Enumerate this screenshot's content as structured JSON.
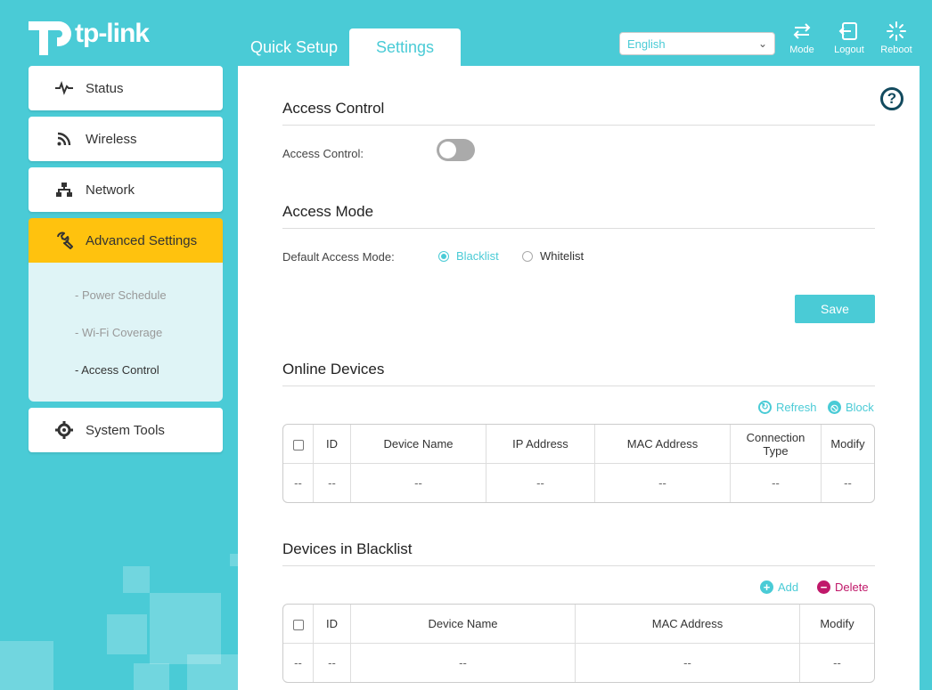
{
  "brand": {
    "name": "tp-link"
  },
  "tabs": {
    "quick_setup": "Quick Setup",
    "settings": "Settings"
  },
  "language": {
    "selected": "English"
  },
  "header_buttons": {
    "mode": "Mode",
    "logout": "Logout",
    "reboot": "Reboot"
  },
  "sidebar": {
    "status": "Status",
    "wireless": "Wireless",
    "network": "Network",
    "advanced": "Advanced Settings",
    "sub_items": [
      "Power Schedule",
      "Wi-Fi Coverage",
      "Access Control"
    ],
    "system_tools": "System Tools"
  },
  "access_control": {
    "title": "Access Control",
    "label": "Access Control:",
    "enabled": false
  },
  "access_mode": {
    "title": "Access Mode",
    "label": "Default Access Mode:",
    "options": [
      "Blacklist",
      "Whitelist"
    ],
    "selected": "Blacklist",
    "save": "Save"
  },
  "online_devices": {
    "title": "Online Devices",
    "refresh": "Refresh",
    "block": "Block",
    "columns": [
      "ID",
      "Device Name",
      "IP Address",
      "MAC Address",
      "Connection Type",
      "Modify"
    ],
    "row": [
      "--",
      "--",
      "--",
      "--",
      "--",
      "--",
      "--"
    ]
  },
  "blacklist": {
    "title": "Devices in Blacklist",
    "add": "Add",
    "delete": "Delete",
    "columns": [
      "ID",
      "Device Name",
      "MAC Address",
      "Modify"
    ],
    "row": [
      "--",
      "--",
      "--",
      "--",
      "--"
    ]
  },
  "colors": {
    "accent": "#4acbd6",
    "active_nav": "#ffc20e",
    "delete": "#c0186a"
  }
}
